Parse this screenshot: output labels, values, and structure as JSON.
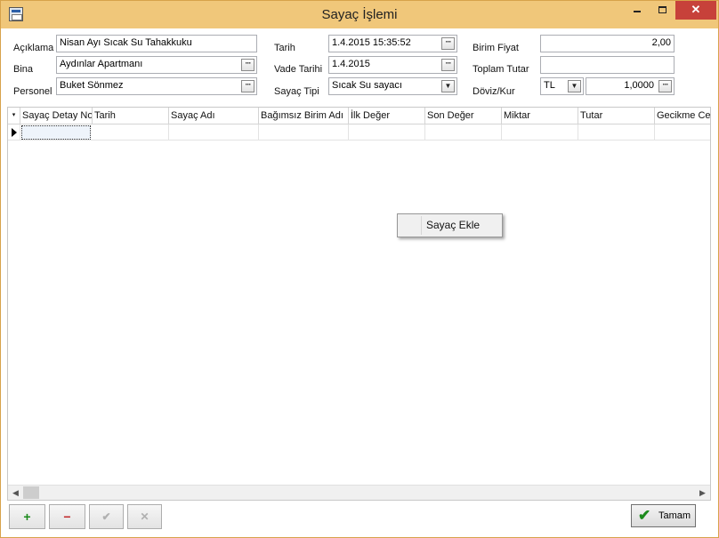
{
  "window": {
    "title": "Sayaç İşlemi",
    "close_label": "✕"
  },
  "form": {
    "aciklama_label": "Açıklama",
    "aciklama_value": "Nisan Ayı Sıcak Su Tahakkuku",
    "bina_label": "Bina",
    "bina_value": "Aydınlar Apartmanı",
    "personel_label": "Personel",
    "personel_value": "Buket Sönmez",
    "tarih_label": "Tarih",
    "tarih_value": "1.4.2015 15:35:52",
    "vade_label": "Vade Tarihi",
    "vade_value": "1.4.2015",
    "sayac_tipi_label": "Sayaç Tipi",
    "sayac_tipi_value": "Sıcak Su sayacı",
    "birim_fiyat_label": "Birim Fiyat",
    "birim_fiyat_value": "2,00",
    "toplam_tutar_label": "Toplam Tutar",
    "toplam_tutar_value": "",
    "doviz_label": "Döviz/Kur",
    "doviz_value": "TL",
    "kur_value": "1,0000",
    "ellipsis": "···",
    "dropdown_arrow": "▼"
  },
  "grid": {
    "columns": [
      "Sayaç Detay No",
      "Tarih",
      "Sayaç Adı",
      "Bağımsız Birim Adı",
      "İlk Değer",
      "Son Değer",
      "Miktar",
      "Tutar",
      "Gecikme Cez"
    ],
    "indicator_glyph": "▾"
  },
  "context_menu": {
    "items": [
      "Sayaç Ekle"
    ]
  },
  "scrollbar": {
    "left": "◀",
    "right": "▶"
  },
  "toolbar": {
    "add": "+",
    "remove": "−",
    "confirm": "✔",
    "cancel": "✕",
    "ok_label": "Tamam",
    "ok_check": "✔"
  },
  "colors": {
    "titlebar": "#f0c77a",
    "close_button": "#c7413a",
    "add_green": "#1c8a1c",
    "remove_red": "#c0282a"
  }
}
